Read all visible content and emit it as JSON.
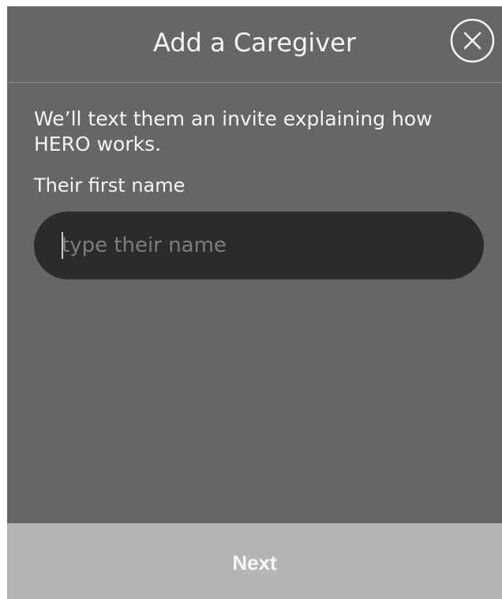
{
  "header": {
    "title": "Add a Caregiver",
    "close_icon": "close-circle-icon"
  },
  "content": {
    "description": "We’ll text them an invite explaining how HERO works.",
    "first_name_label": "Their first name",
    "first_name_input": {
      "value": "",
      "placeholder": "type their name"
    }
  },
  "footer": {
    "next_label": "Next"
  },
  "colors": {
    "background": "#666666",
    "input_background": "#2b2b2b",
    "footer_background": "#b5b5b5",
    "text": "#f4f4f4"
  }
}
